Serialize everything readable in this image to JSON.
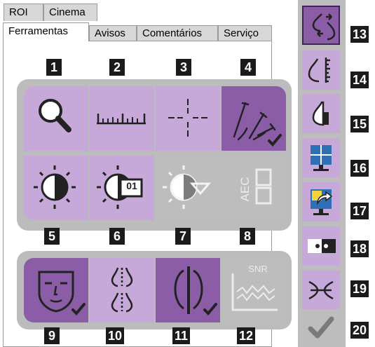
{
  "top_tabs": [
    {
      "label": "ROI"
    },
    {
      "label": "Cinema"
    }
  ],
  "tabs": [
    {
      "label": "Ferramentas",
      "active": true
    },
    {
      "label": "Avisos"
    },
    {
      "label": "Comentários"
    },
    {
      "label": "Serviço"
    }
  ],
  "tools": [
    {
      "number": "1",
      "icon": "magnifier-icon"
    },
    {
      "number": "2",
      "icon": "ruler-icon"
    },
    {
      "number": "3",
      "icon": "crosshair-icon"
    },
    {
      "number": "4",
      "icon": "annotation-pens-icon",
      "selected": true
    },
    {
      "number": "5",
      "icon": "contrast-icon"
    },
    {
      "number": "6",
      "icon": "contrast-preset-icon",
      "preset_label": "01"
    },
    {
      "number": "7",
      "icon": "auto-contrast-icon",
      "disabled": true
    },
    {
      "number": "8",
      "icon": "aec-icon",
      "text": "AEC",
      "disabled": true
    },
    {
      "number": "9",
      "icon": "face-mask-icon",
      "selected": true
    },
    {
      "number": "10",
      "icon": "breast-outline-icon"
    },
    {
      "number": "11",
      "icon": "implant-icon",
      "selected": true
    },
    {
      "number": "12",
      "icon": "snr-icon",
      "text": "SNR",
      "disabled": true
    }
  ],
  "sidebar": [
    {
      "number": "13",
      "icon": "swap-breasts-icon"
    },
    {
      "number": "14",
      "icon": "breast-ruler-icon"
    },
    {
      "number": "15",
      "icon": "breast-shaded-icon"
    },
    {
      "number": "16",
      "icon": "grid-monitor-icon"
    },
    {
      "number": "17",
      "icon": "send-monitor-icon"
    },
    {
      "number": "18",
      "icon": "dots-icon"
    },
    {
      "number": "19",
      "icon": "mirror-icon"
    },
    {
      "number": "20",
      "icon": "checkmark-icon"
    }
  ],
  "colors": {
    "tool": "#c7a9d9",
    "tool_selected": "#8b5da6",
    "tool_disabled": "#bdbdbd",
    "sidebar_bg": "#bdbdbd"
  }
}
